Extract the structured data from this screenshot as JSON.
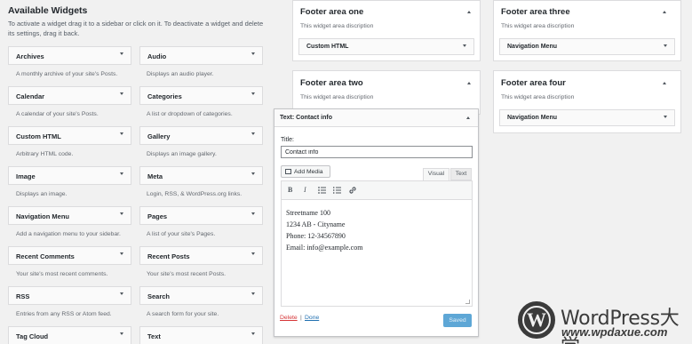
{
  "available": {
    "title": "Available Widgets",
    "description": "To activate a widget drag it to a sidebar or click on it. To deactivate a widget and delete its settings, drag it back.",
    "left_column": [
      {
        "name": "Archives",
        "desc": "A monthly archive of your site's Posts."
      },
      {
        "name": "Calendar",
        "desc": "A calendar of your site's Posts."
      },
      {
        "name": "Custom HTML",
        "desc": "Arbitrary HTML code."
      },
      {
        "name": "Image",
        "desc": "Displays an image."
      },
      {
        "name": "Navigation Menu",
        "desc": "Add a navigation menu to your sidebar."
      },
      {
        "name": "Recent Comments",
        "desc": "Your site's most recent comments."
      },
      {
        "name": "RSS",
        "desc": "Entries from any RSS or Atom feed."
      },
      {
        "name": "Tag Cloud",
        "desc": ""
      }
    ],
    "right_column": [
      {
        "name": "Audio",
        "desc": "Displays an audio player."
      },
      {
        "name": "Categories",
        "desc": "A list or dropdown of categories."
      },
      {
        "name": "Gallery",
        "desc": "Displays an image gallery."
      },
      {
        "name": "Meta",
        "desc": "Login, RSS, & WordPress.org links."
      },
      {
        "name": "Pages",
        "desc": "A list of your site's Pages."
      },
      {
        "name": "Recent Posts",
        "desc": "Your site's most recent Posts."
      },
      {
        "name": "Search",
        "desc": "A search form for your site."
      },
      {
        "name": "Text",
        "desc": ""
      }
    ]
  },
  "areas": {
    "one": {
      "title": "Footer area one",
      "desc": "This widget area discription",
      "widget": "Custom HTML"
    },
    "two": {
      "title": "Footer area two",
      "desc": "This widget area discription"
    },
    "three": {
      "title": "Footer area three",
      "desc": "This widget area discription",
      "widget": "Navigation Menu"
    },
    "four": {
      "title": "Footer area four",
      "desc": "This widget area discription",
      "widget": "Navigation Menu"
    }
  },
  "editor": {
    "header": "Text: Contact info",
    "title_label": "Title:",
    "title_value": "Contact info",
    "add_media": "Add Media",
    "tab_visual": "Visual",
    "tab_text": "Text",
    "toolbar": {
      "bold": "B",
      "italic": "I"
    },
    "content_lines": [
      "Streetname 100",
      "1234 AB - Cityname",
      "Phone: 12-34567890",
      "Email: info@example.com"
    ],
    "delete": "Delete",
    "separator": "|",
    "done": "Done",
    "saved": "Saved"
  },
  "watermark": {
    "logo_letter": "W",
    "title": "WordPress大学",
    "url": "www.wpdaxue.com"
  },
  "colors": {
    "primary": "#2271b1",
    "saved_button": "#5ea7d6",
    "delete": "#d63638",
    "background": "#f1f1f1"
  }
}
